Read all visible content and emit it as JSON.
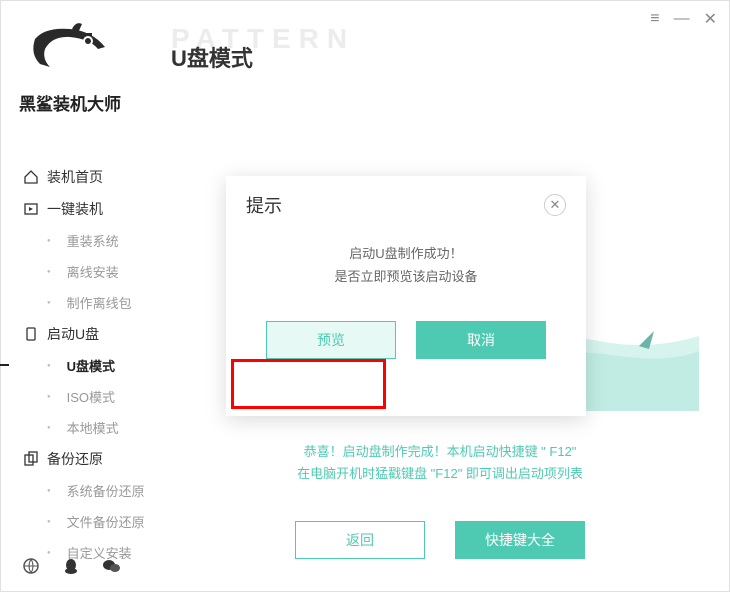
{
  "brand": {
    "name": "黑鲨装机大师"
  },
  "page": {
    "bg_text": "PATTERN",
    "title": "U盘模式"
  },
  "titlebar": {
    "menu": "≡",
    "min": "—",
    "close": "✕"
  },
  "sidebar": {
    "items": [
      {
        "label": "装机首页",
        "sub": false
      },
      {
        "label": "一键装机",
        "sub": false
      },
      {
        "label": "重装系统",
        "sub": true
      },
      {
        "label": "离线安装",
        "sub": true
      },
      {
        "label": "制作离线包",
        "sub": true
      },
      {
        "label": "启动U盘",
        "sub": false
      },
      {
        "label": "U盘模式",
        "sub": true,
        "active": true
      },
      {
        "label": "ISO模式",
        "sub": true
      },
      {
        "label": "本地模式",
        "sub": true
      },
      {
        "label": "备份还原",
        "sub": false
      },
      {
        "label": "系统备份还原",
        "sub": true
      },
      {
        "label": "文件备份还原",
        "sub": true
      },
      {
        "label": "自定义安装",
        "sub": true
      }
    ]
  },
  "main": {
    "success_line1": "恭喜！启动盘制作完成！本机启动快捷键 \" F12\"",
    "success_line2": "在电脑开机时猛戳键盘 \"F12\" 即可调出启动项列表",
    "back_label": "返回",
    "hotkey_label": "快捷键大全"
  },
  "dialog": {
    "title": "提示",
    "body_line1": "启动U盘制作成功！",
    "body_line2": "是否立即预览该启动设备",
    "preview_label": "预览",
    "cancel_label": "取消"
  }
}
